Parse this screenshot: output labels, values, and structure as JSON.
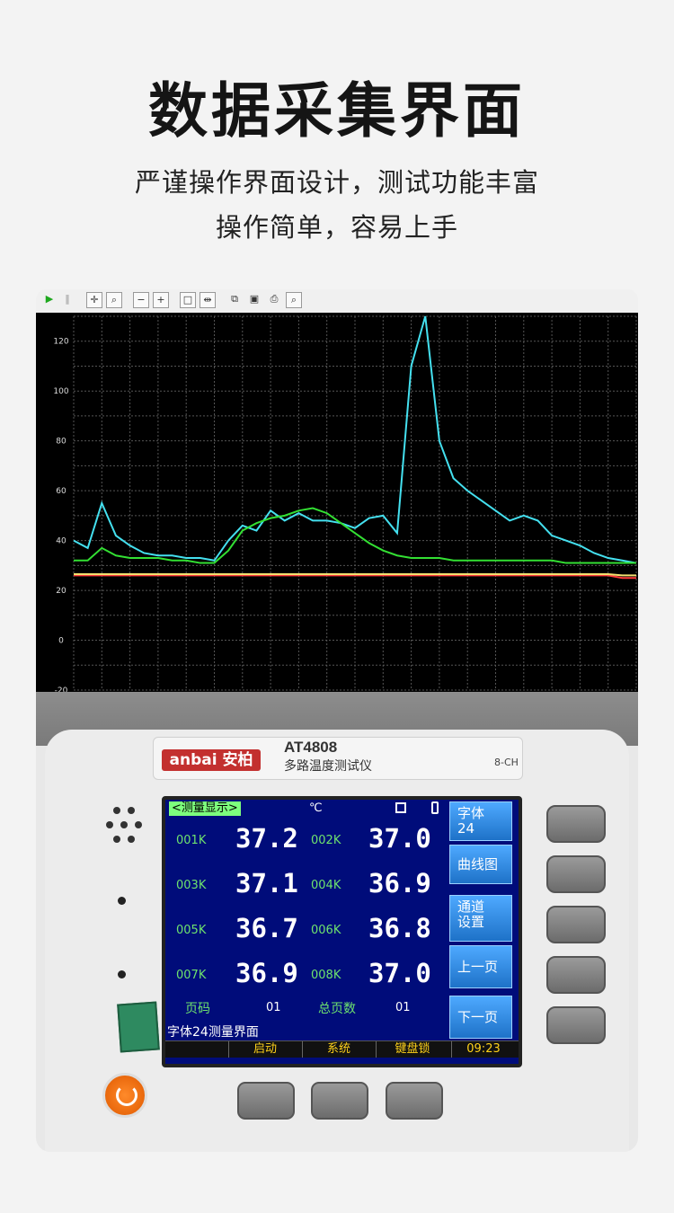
{
  "headline": "数据采集界面",
  "subtitle_line1": "严谨操作界面设计，测试功能丰富",
  "subtitle_line2": "操作简单，容易上手",
  "toolbar": {
    "buttons": [
      "play-icon",
      "pause-icon",
      "pan-icon",
      "zoom-area-icon",
      "zoom-out-icon",
      "zoom-in-icon",
      "select-icon",
      "split-icon",
      "copy-icon",
      "save-icon",
      "print-icon",
      "preview-icon"
    ]
  },
  "chart_data": {
    "type": "line",
    "yticks": [
      "120",
      "100",
      "80",
      "60",
      "40",
      "20",
      "0",
      "-20"
    ],
    "ylim": [
      -20,
      130
    ],
    "grid": true,
    "x": [
      0,
      1,
      2,
      3,
      4,
      5,
      6,
      7,
      8,
      9,
      10,
      11,
      12,
      13,
      14,
      15,
      16,
      17,
      18,
      19,
      20,
      21,
      22,
      23,
      24,
      25,
      26,
      27,
      28,
      29,
      30,
      31,
      32,
      33,
      34,
      35,
      36,
      37,
      38,
      39,
      40
    ],
    "series": [
      {
        "color": "#44e0ef",
        "values": [
          40,
          37,
          55,
          42,
          38,
          35,
          34,
          34,
          33,
          33,
          32,
          40,
          46,
          44,
          52,
          48,
          51,
          48,
          48,
          47,
          45,
          49,
          50,
          43,
          110,
          130,
          80,
          65,
          60,
          56,
          52,
          48,
          50,
          48,
          42,
          40,
          38,
          35,
          33,
          32,
          31
        ]
      },
      {
        "color": "#33e033",
        "values": [
          32,
          32,
          37,
          34,
          33,
          33,
          33,
          32,
          32,
          31,
          31,
          36,
          44,
          47,
          49,
          50,
          52,
          53,
          51,
          47,
          43,
          39,
          36,
          34,
          33,
          33,
          33,
          32,
          32,
          32,
          32,
          32,
          32,
          32,
          32,
          31,
          31,
          31,
          31,
          31,
          31
        ]
      },
      {
        "color": "#ff3a3a",
        "values": [
          26,
          26,
          26,
          26,
          26,
          26,
          26,
          26,
          26,
          26,
          26,
          26,
          26,
          26,
          26,
          26,
          26,
          26,
          26,
          26,
          26,
          26,
          26,
          26,
          26,
          26,
          26,
          26,
          26,
          26,
          26,
          26,
          26,
          26,
          26,
          26,
          26,
          26,
          26,
          25,
          25
        ]
      },
      {
        "color": "#f2e070",
        "values": [
          26.5,
          26.5,
          26.5,
          26.5,
          26.5,
          26.5,
          26.5,
          26.5,
          26.5,
          26.5,
          26.5,
          26.5,
          26.5,
          26.5,
          26.5,
          26.5,
          26.5,
          26.5,
          26.5,
          26.5,
          26.5,
          26.5,
          26.5,
          26.5,
          26.5,
          26.5,
          26.5,
          26.5,
          26.5,
          26.5,
          26.5,
          26.5,
          26.5,
          26.5,
          26.5,
          26.5,
          26.5,
          26.5,
          26.5,
          26,
          26
        ]
      }
    ]
  },
  "device": {
    "logo": "anbai 安柏",
    "model": "AT4808",
    "model_name": "多路温度测试仪",
    "channels": "8-CH"
  },
  "screen": {
    "title": "<测量显示>",
    "unit": "℃",
    "readings": [
      {
        "label": "001K",
        "value": "37.2"
      },
      {
        "label": "002K",
        "value": "37.0"
      },
      {
        "label": "003K",
        "value": "37.1"
      },
      {
        "label": "004K",
        "value": "36.9"
      },
      {
        "label": "005K",
        "value": "36.7"
      },
      {
        "label": "006K",
        "value": "36.8"
      },
      {
        "label": "007K",
        "value": "36.9"
      },
      {
        "label": "008K",
        "value": "37.0"
      }
    ],
    "page_label": "页码",
    "page_value": "01",
    "total_label": "总页数",
    "total_value": "01",
    "status_line": "字体24测量界面",
    "softkeys": [
      "字体\n24",
      "曲线图",
      "通道\n设置",
      "上一页",
      "下一页"
    ],
    "bottom": {
      "start": "启动",
      "system": "系统",
      "keylock": "键盘锁",
      "time": "09:23"
    }
  }
}
